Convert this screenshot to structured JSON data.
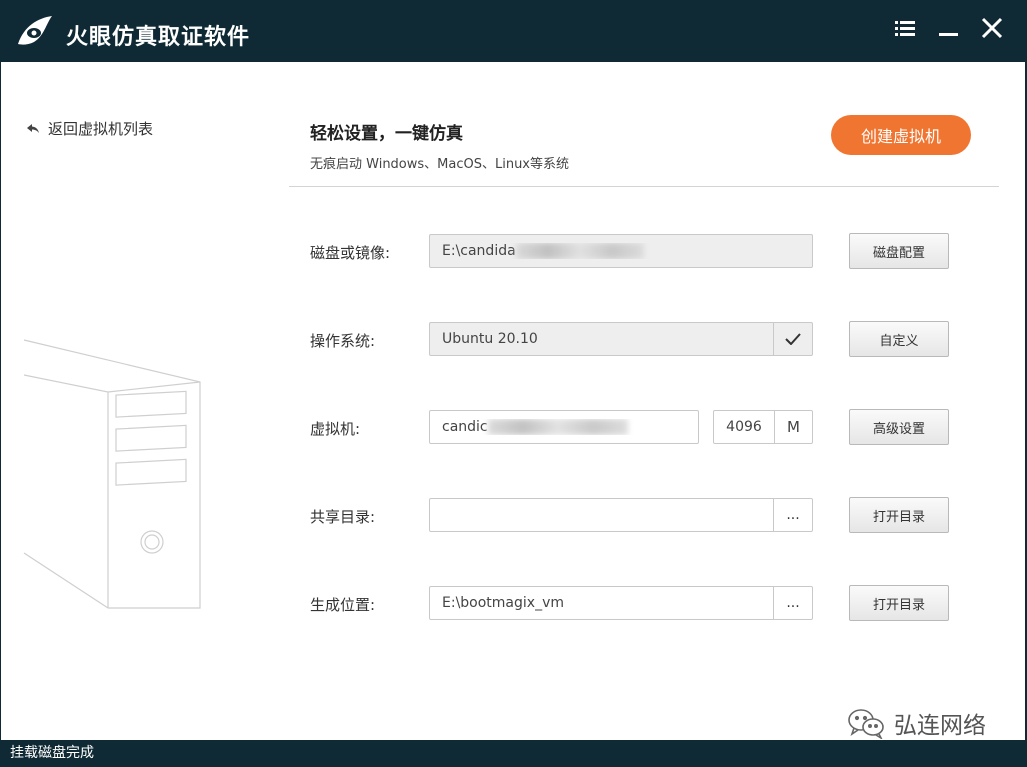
{
  "app": {
    "title": "火眼仿真取证软件"
  },
  "nav": {
    "back_label": "返回虚拟机列表"
  },
  "header": {
    "title": "轻松设置，一键仿真",
    "subtitle": "无痕启动 Windows、MacOS、Linux等系统",
    "create_button": "创建虚拟机"
  },
  "form": {
    "disk": {
      "label": "磁盘或镜像:",
      "value": "E:\\candida",
      "button": "磁盘配置"
    },
    "os": {
      "label": "操作系统:",
      "value": "Ubuntu 20.10",
      "button": "自定义"
    },
    "vm": {
      "label": "虚拟机:",
      "value": "candic",
      "memory": "4096",
      "memory_unit": "M",
      "button": "高级设置"
    },
    "share": {
      "label": "共享目录:",
      "value": "",
      "browse": "...",
      "button": "打开目录"
    },
    "output": {
      "label": "生成位置:",
      "value": "E:\\bootmagix_vm",
      "browse": "...",
      "button": "打开目录"
    }
  },
  "watermark": {
    "text": "弘连网络"
  },
  "status": {
    "text": "挂载磁盘完成"
  },
  "colors": {
    "titlebar": "#0f2a35",
    "accent": "#f07531"
  },
  "icons": {
    "logo": "eye-logo-icon",
    "menu": "menu-list-icon",
    "minimize": "minimize-icon",
    "close": "close-icon",
    "back": "back-arrow-icon",
    "os_select": "checkmark-icon",
    "watermark": "wechat-icon"
  }
}
